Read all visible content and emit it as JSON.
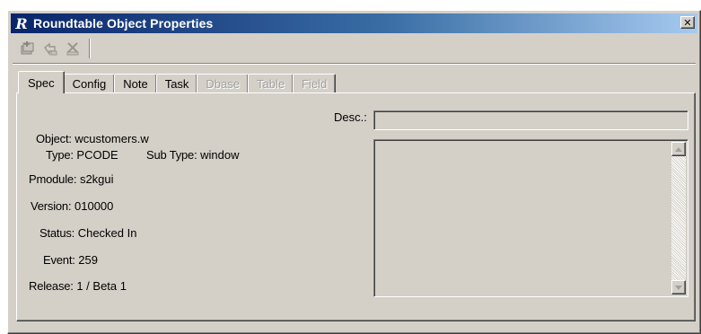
{
  "window": {
    "title": "Roundtable Object Properties",
    "app_icon_letter": "R",
    "close_glyph": "✕"
  },
  "toolbar": {
    "buttons": [
      {
        "icon": "add-object-icon",
        "enabled": false
      },
      {
        "icon": "undo-icon",
        "enabled": false
      },
      {
        "icon": "delete-icon",
        "enabled": false
      }
    ]
  },
  "tabs": [
    {
      "label": "Spec",
      "active": true,
      "enabled": true
    },
    {
      "label": "Config",
      "active": false,
      "enabled": true
    },
    {
      "label": "Note",
      "active": false,
      "enabled": true
    },
    {
      "label": "Task",
      "active": false,
      "enabled": true
    },
    {
      "label": "Dbase",
      "active": false,
      "enabled": false
    },
    {
      "label": "Table",
      "active": false,
      "enabled": false
    },
    {
      "label": "Field",
      "active": false,
      "enabled": false
    }
  ],
  "spec": {
    "object_label": "Object:",
    "object_value": "wcustomers.w",
    "type_label": "Type:",
    "type_value": "PCODE",
    "subtype_label": "Sub Type:",
    "subtype_value": "window",
    "pmodule_label": "Pmodule:",
    "pmodule_value": "s2kgui",
    "version_label": "Version:",
    "version_value": "010000",
    "status_label": "Status:",
    "status_value": "Checked In",
    "event_label": "Event:",
    "event_value": "259",
    "release_label": "Release:",
    "release_value": "1 / Beta 1",
    "desc_label": "Desc.:",
    "desc_value": ""
  },
  "colors": {
    "title_start": "#0a246a",
    "title_end": "#a6caf0",
    "face": "#d4d0c8",
    "disabled_text": "#a0a0a0"
  }
}
